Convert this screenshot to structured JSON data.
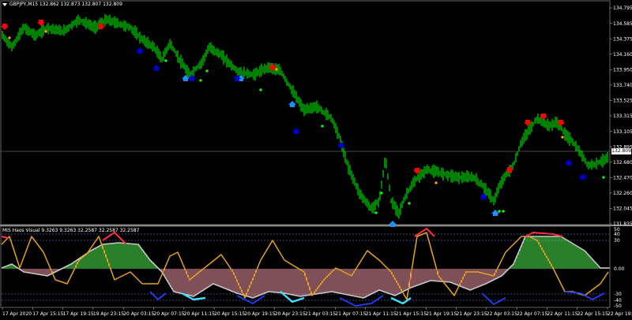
{
  "main_pane": {
    "title": "GBPJPY,M15  132.862 132.873 132.807 132.809",
    "price_levels": [
      "134.795",
      "134.585",
      "134.375",
      "134.160",
      "133.950",
      "133.740",
      "133.525",
      "133.315",
      "133.105",
      "132.895",
      "132.680",
      "132.470",
      "132.260",
      "132.045",
      "131.835"
    ],
    "current_price": "132.809"
  },
  "indicator_pane": {
    "title": "MIS Haos Visual 9.3263 9.3263 32.2587 32.2587 32.2587",
    "levels": [
      "50",
      "40",
      "30",
      "0.00",
      "-30",
      "-40",
      "-50"
    ]
  },
  "time_axis": [
    "17 Apr 2020",
    "17 Apr 15:15",
    "17 Apr 19:15",
    "19 Apr 23:15",
    "20 Apr 03:15",
    "20 Apr 07:15",
    "20 Apr 11:15",
    "20 Apr 15:15",
    "20 Apr 19:15",
    "20 Apr 23:15",
    "21 Apr 03:15",
    "21 Apr 07:15",
    "21 Apr 11:15",
    "21 Apr 15:15",
    "21 Apr 19:15",
    "21 Apr 23:15",
    "22 Apr 03:15",
    "22 Apr 07:15",
    "22 Apr 11:15",
    "22 Apr 15:15",
    "22 Apr 19:15"
  ],
  "colors": {
    "background": "#000000",
    "candle": "#00ff00",
    "sell_arrow": "#ff0000",
    "buy_arrow_dark": "#0000cd",
    "buy_arrow_light": "#1e90ff",
    "dot_green": "#00ff00",
    "dot_orange": "#ffa500",
    "hist_pink": "#ff9fb2",
    "hist_green": "#55ff55",
    "line_orange": "#e6a020",
    "line_gray": "#c8c8c8",
    "line_blue": "#2040ff",
    "line_cyan": "#40e0ff",
    "line_red": "#ff3040",
    "grid_level": "#8080ff"
  }
}
